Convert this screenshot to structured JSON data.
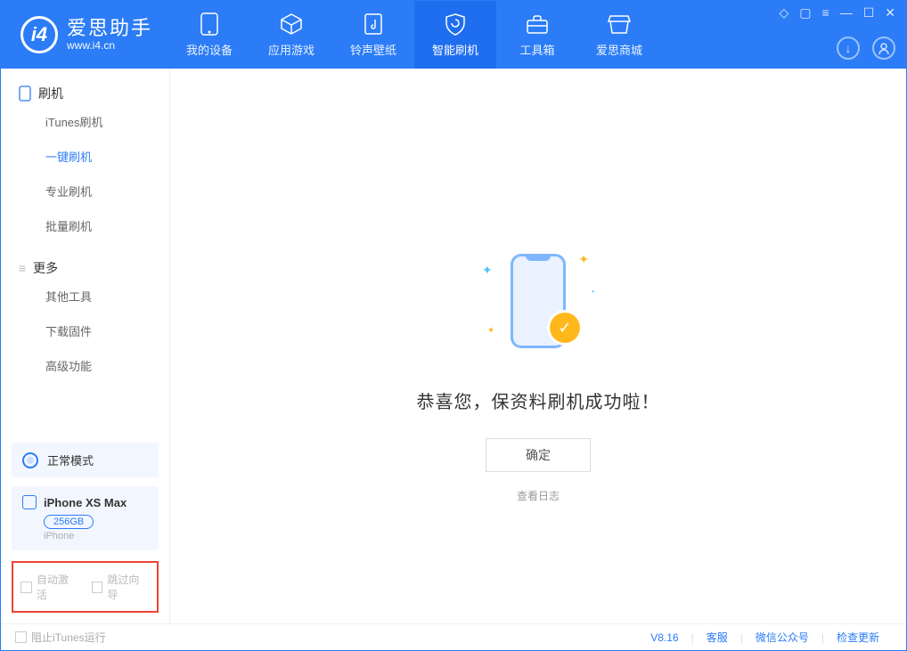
{
  "logo": {
    "title": "爱思助手",
    "subtitle": "www.i4.cn"
  },
  "tabs": [
    {
      "label": "我的设备"
    },
    {
      "label": "应用游戏"
    },
    {
      "label": "铃声壁纸"
    },
    {
      "label": "智能刷机"
    },
    {
      "label": "工具箱"
    },
    {
      "label": "爱思商城"
    }
  ],
  "sidebar": {
    "group1": "刷机",
    "items1": [
      {
        "label": "iTunes刷机"
      },
      {
        "label": "一键刷机"
      },
      {
        "label": "专业刷机"
      },
      {
        "label": "批量刷机"
      }
    ],
    "group2": "更多",
    "items2": [
      {
        "label": "其他工具"
      },
      {
        "label": "下载固件"
      },
      {
        "label": "高级功能"
      }
    ],
    "mode": "正常模式",
    "device": {
      "name": "iPhone XS Max",
      "storage": "256GB",
      "type": "iPhone"
    },
    "opt1": "自动激活",
    "opt2": "跳过向导"
  },
  "main": {
    "success": "恭喜您，保资料刷机成功啦！",
    "ok": "确定",
    "log": "查看日志"
  },
  "footer": {
    "block_itunes": "阻止iTunes运行",
    "version": "V8.16",
    "support": "客服",
    "wechat": "微信公众号",
    "update": "检查更新"
  }
}
